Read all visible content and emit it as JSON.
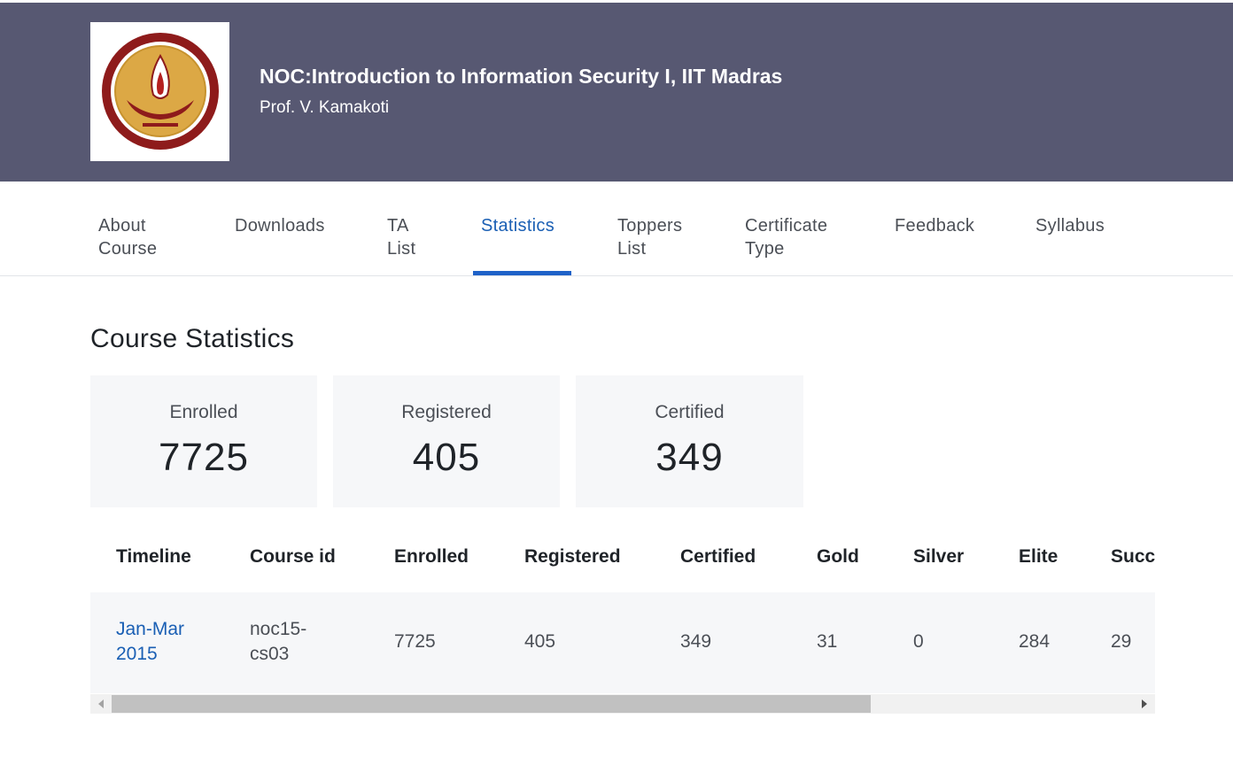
{
  "header": {
    "course_title": "NOC:Introduction to Information Security I, IIT Madras",
    "professor": "Prof. V. Kamakoti",
    "logo_icon": "iit-madras-seal-icon",
    "background_color": "#575872"
  },
  "tabs": [
    {
      "label_line1": "About",
      "label_line2": "Course"
    },
    {
      "label_line1": "Downloads",
      "label_line2": ""
    },
    {
      "label_line1": "TA",
      "label_line2": "List"
    },
    {
      "label_line1": "Statistics",
      "label_line2": "",
      "active": true
    },
    {
      "label_line1": "Toppers",
      "label_line2": "List"
    },
    {
      "label_line1": "Certificate",
      "label_line2": "Type"
    },
    {
      "label_line1": "Feedback",
      "label_line2": ""
    },
    {
      "label_line1": "Syllabus",
      "label_line2": ""
    }
  ],
  "accent_color": "#1f62c8",
  "statistics": {
    "title": "Course Statistics",
    "cards": [
      {
        "label": "Enrolled",
        "value": "7725"
      },
      {
        "label": "Registered",
        "value": "405"
      },
      {
        "label": "Certified",
        "value": "349"
      }
    ]
  },
  "table": {
    "columns": [
      "Timeline",
      "Course id",
      "Enrolled",
      "Registered",
      "Certified",
      "Gold",
      "Silver",
      "Elite",
      "Succ"
    ],
    "rows": [
      {
        "timeline_line1": "Jan-Mar",
        "timeline_line2": "2015",
        "course_id_line1": "noc15-",
        "course_id_line2": "cs03",
        "enrolled": "7725",
        "registered": "405",
        "certified": "349",
        "gold": "31",
        "silver": "0",
        "elite": "284",
        "successful": "29"
      }
    ]
  }
}
